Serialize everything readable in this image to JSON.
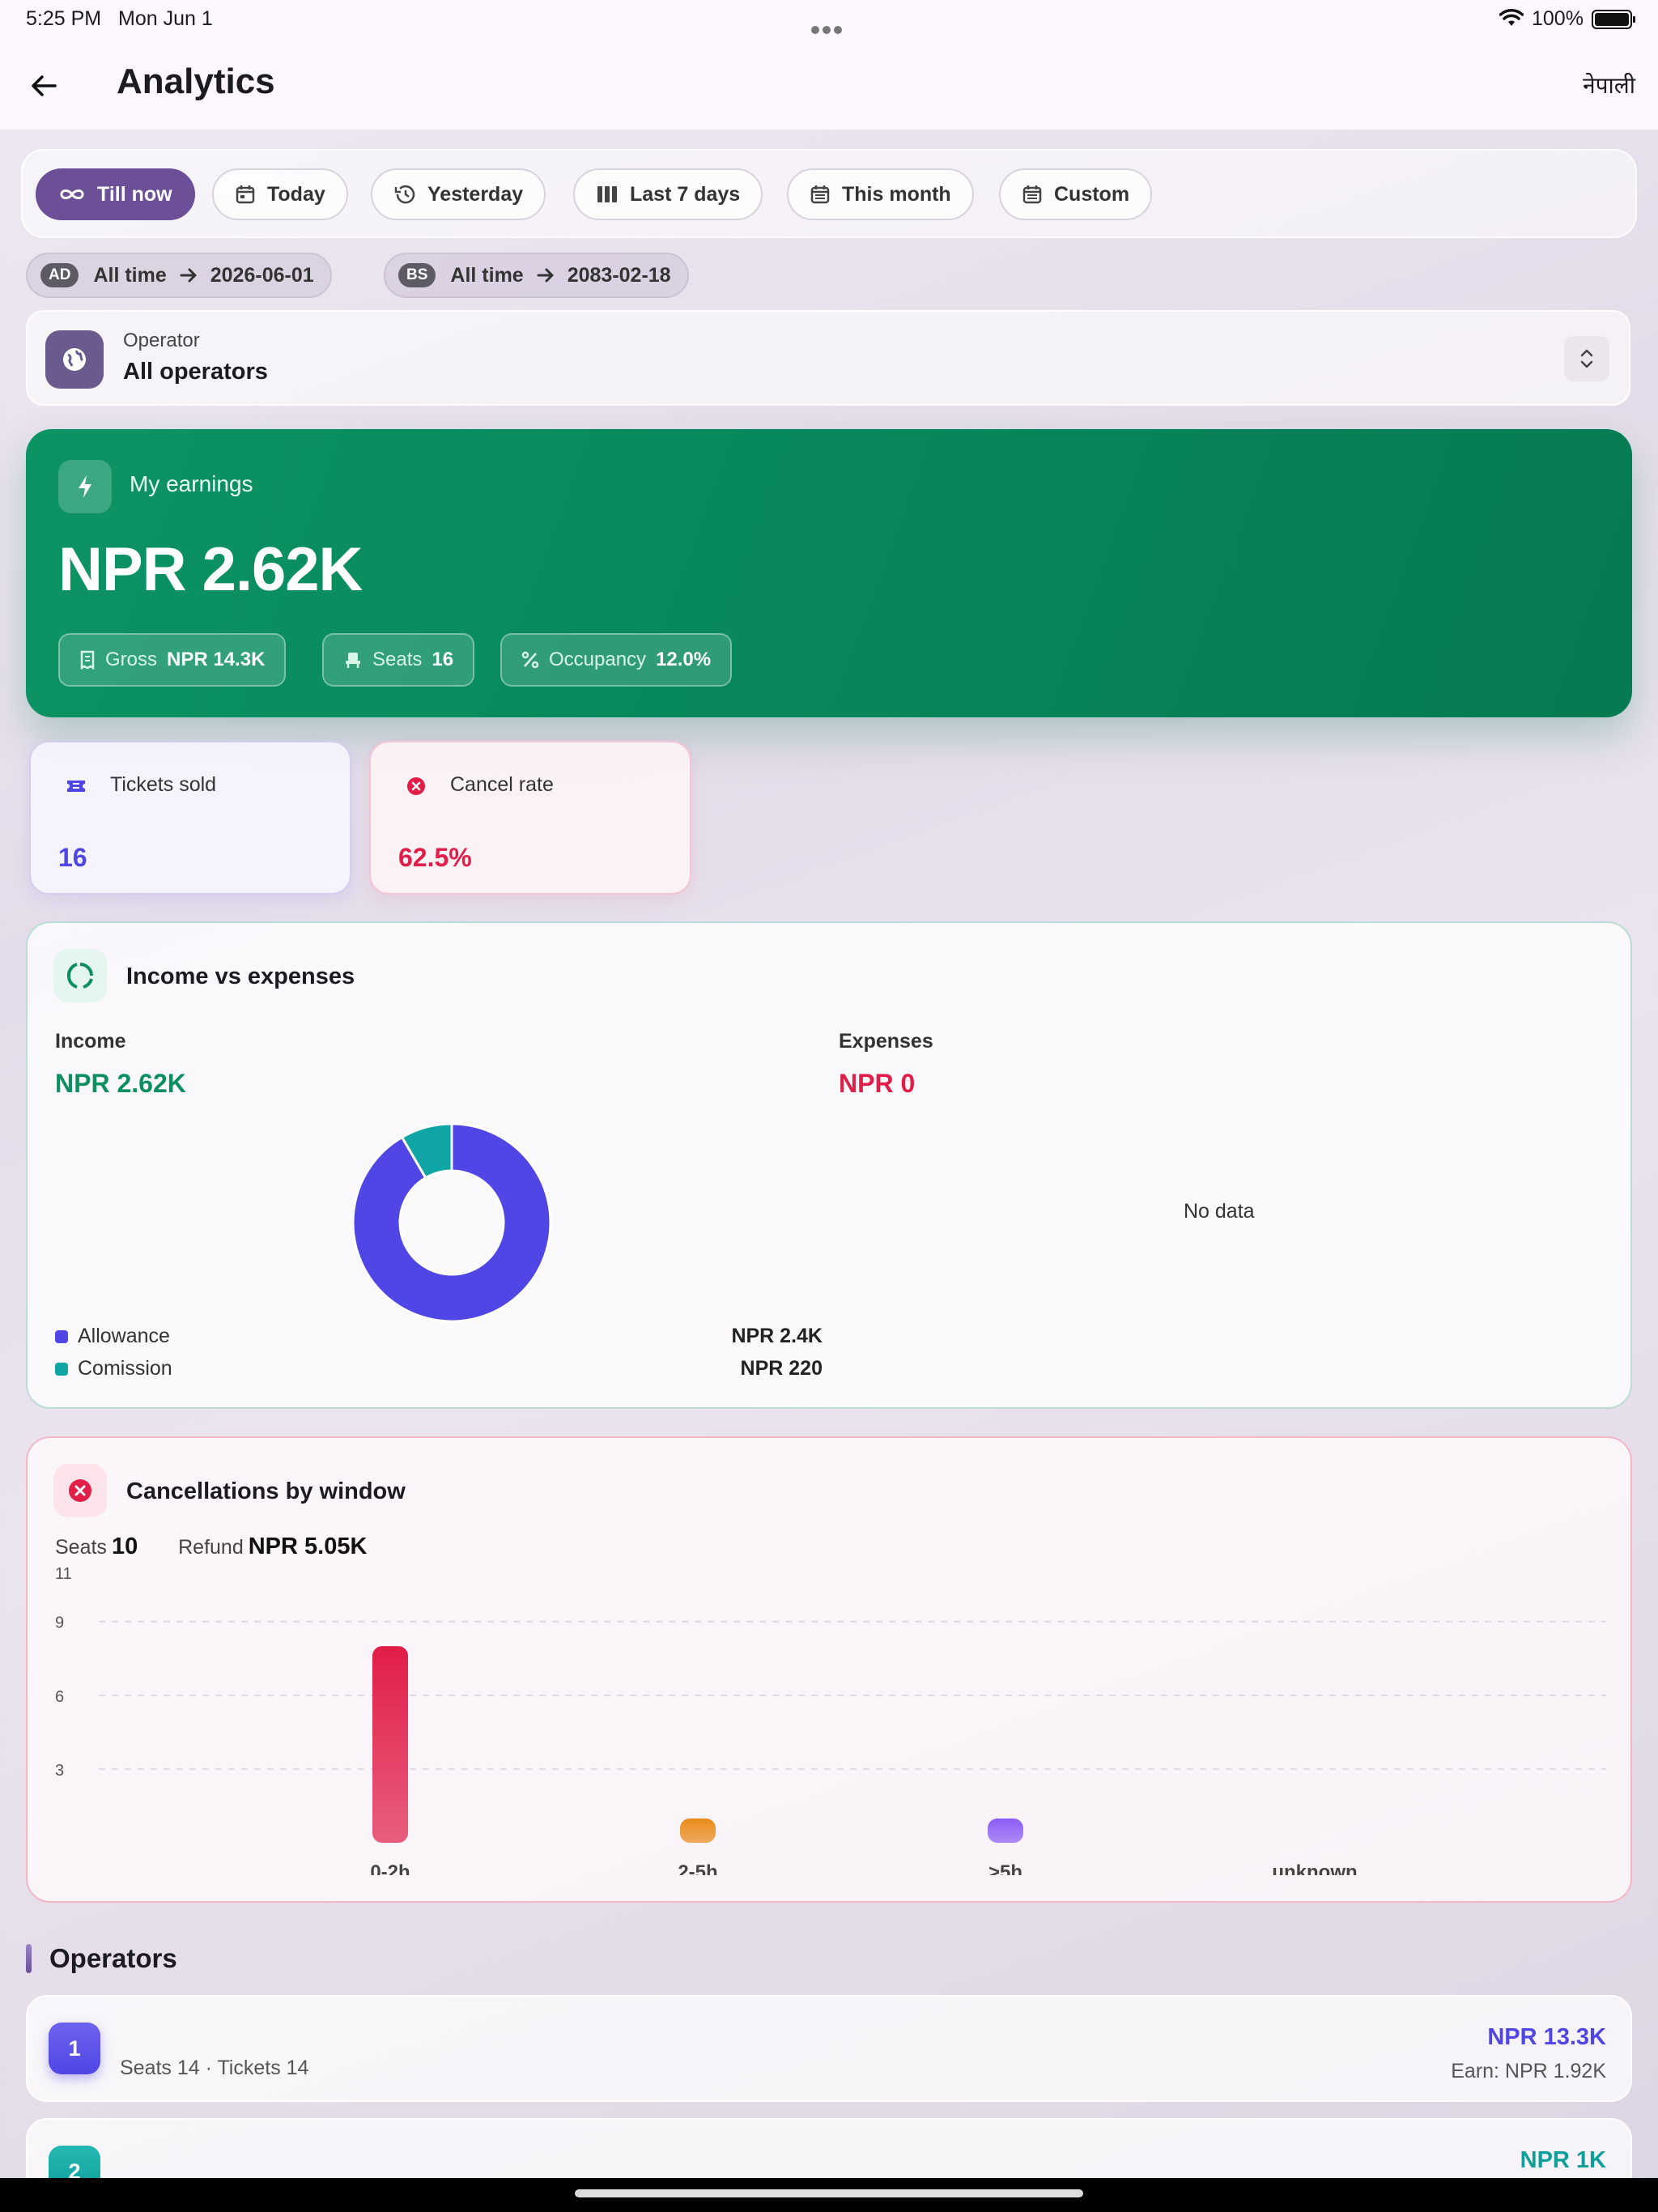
{
  "status": {
    "time": "5:25 PM",
    "date": "Mon Jun 1",
    "battery": "100%"
  },
  "appbar": {
    "title": "Analytics",
    "language": "नेपाली"
  },
  "filters": [
    {
      "label": "Till now",
      "icon": "infinity-icon"
    },
    {
      "label": "Today",
      "icon": "calendar-icon"
    },
    {
      "label": "Yesterday",
      "icon": "history-icon"
    },
    {
      "label": "Last 7 days",
      "icon": "columns-icon"
    },
    {
      "label": "This month",
      "icon": "calendar-icon"
    },
    {
      "label": "Custom",
      "icon": "calendar-icon"
    }
  ],
  "ranges": {
    "ad": {
      "tag": "AD",
      "from": "All time",
      "to": "2026-06-01"
    },
    "bs": {
      "tag": "BS",
      "from": "All time",
      "to": "2083-02-18"
    }
  },
  "operator_select": {
    "label": "Operator",
    "value": "All operators"
  },
  "earnings": {
    "label": "My earnings",
    "amount": "NPR 2.62K",
    "gross_label": "Gross",
    "gross_value": "NPR 14.3K",
    "seats_label": "Seats",
    "seats_value": "16",
    "occupancy_label": "Occupancy",
    "occupancy_value": "12.0%"
  },
  "stats": {
    "tickets_label": "Tickets sold",
    "tickets_value": "16",
    "cancel_label": "Cancel rate",
    "cancel_value": "62.5%"
  },
  "income_expenses": {
    "title": "Income vs expenses",
    "income_label": "Income",
    "income_amount": "NPR 2.62K",
    "expenses_label": "Expenses",
    "expenses_amount": "NPR 0",
    "no_data": "No data",
    "legend": [
      {
        "name": "Allowance",
        "value": "NPR 2.4K"
      },
      {
        "name": "Comission",
        "value": "NPR 220"
      }
    ]
  },
  "cancellations": {
    "title": "Cancellations by window",
    "seats_label": "Seats",
    "seats_value": "10",
    "refund_label": "Refund",
    "refund_value": "NPR 5.05K"
  },
  "operators": {
    "title": "Operators",
    "rows": [
      {
        "rank": "1",
        "sub": "Seats 14 · Tickets 14",
        "amount": "NPR 13.3K",
        "earn": "Earn: NPR 1.92K",
        "color": "#4f46e5"
      },
      {
        "rank": "2",
        "sub": "",
        "amount": "NPR 1K",
        "earn": "",
        "color": "#0e9f9b"
      }
    ]
  },
  "chart_data": [
    {
      "type": "pie",
      "subtype": "donut",
      "title": "Income",
      "categories": [
        "Allowance",
        "Comission"
      ],
      "values": [
        2400,
        220
      ],
      "colors": [
        "#4f46e5",
        "#0ea5a4"
      ]
    },
    {
      "type": "bar",
      "title": "Cancellations by window",
      "categories": [
        "0-2h",
        "2-5h",
        ">5h",
        "unknown"
      ],
      "values": [
        8,
        0,
        0,
        0
      ],
      "colors": [
        "#e11d48",
        "#ea8a1a",
        "#8b5cf6",
        "#9ca3af"
      ],
      "yticks": [
        3,
        6,
        9,
        11
      ],
      "ylim": [
        0,
        11
      ],
      "grid": true
    }
  ]
}
